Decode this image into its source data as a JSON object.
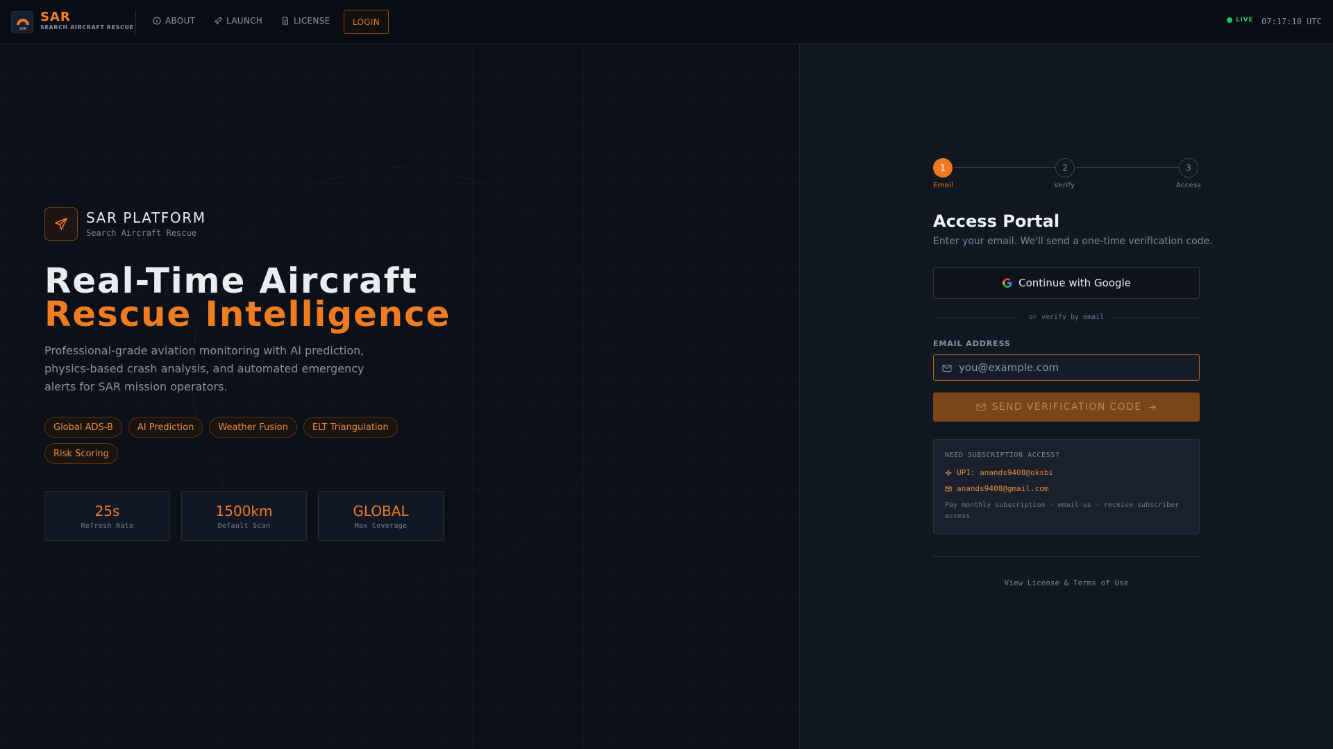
{
  "brand": {
    "title": "SAR",
    "subtitle": "SEARCH AIRCRAFT RESCUE",
    "logo_text": "SAR"
  },
  "nav": {
    "items": [
      {
        "label": "ABOUT",
        "icon": "info-circle-icon"
      },
      {
        "label": "LAUNCH",
        "icon": "rocket-icon"
      },
      {
        "label": "LICENSE",
        "icon": "document-icon"
      }
    ],
    "login_label": "LOGIN"
  },
  "status": {
    "live_label": "LIVE",
    "clock": "07:17:10 UTC",
    "live_color": "#22c55e"
  },
  "hero": {
    "platform_title": "SAR PLATFORM",
    "platform_subtitle": "Search Aircraft Rescue",
    "headline_line1": "Real-Time Aircraft",
    "headline_line2": "Rescue Intelligence",
    "description": "Professional-grade aviation monitoring with AI prediction, physics-based crash analysis, and automated emergency alerts for SAR mission operators.",
    "tags": [
      "Global ADS-B",
      "AI Prediction",
      "Weather Fusion",
      "ELT Triangulation",
      "Risk Scoring"
    ],
    "stats": [
      {
        "value": "25s",
        "label": "Refresh Rate"
      },
      {
        "value": "1500km",
        "label": "Default Scan"
      },
      {
        "value": "GLOBAL",
        "label": "Max Coverage"
      }
    ]
  },
  "auth": {
    "steps": [
      {
        "number": "1",
        "label": "Email",
        "active": true
      },
      {
        "number": "2",
        "label": "Verify",
        "active": false
      },
      {
        "number": "3",
        "label": "Access",
        "active": false
      }
    ],
    "title": "Access Portal",
    "subtitle": "Enter your email. We'll send a one-time verification code.",
    "google_label": "Continue with Google",
    "divider_text": "or verify by email",
    "email_label": "EMAIL ADDRESS",
    "email_placeholder": "you@example.com",
    "email_value": "",
    "send_label": "SEND VERIFICATION CODE",
    "subscription": {
      "heading": "NEED SUBSCRIPTION ACCESS?",
      "upi": "UPI: anands9408@oksbi",
      "email": "anands9408@gmail.com",
      "note": "Pay monthly subscription - email us - receive subscriber access"
    },
    "license_link": "View License & Terms of Use"
  },
  "colors": {
    "accent": "#ef7a22",
    "background": "#0c1018",
    "panel": "#121822"
  }
}
